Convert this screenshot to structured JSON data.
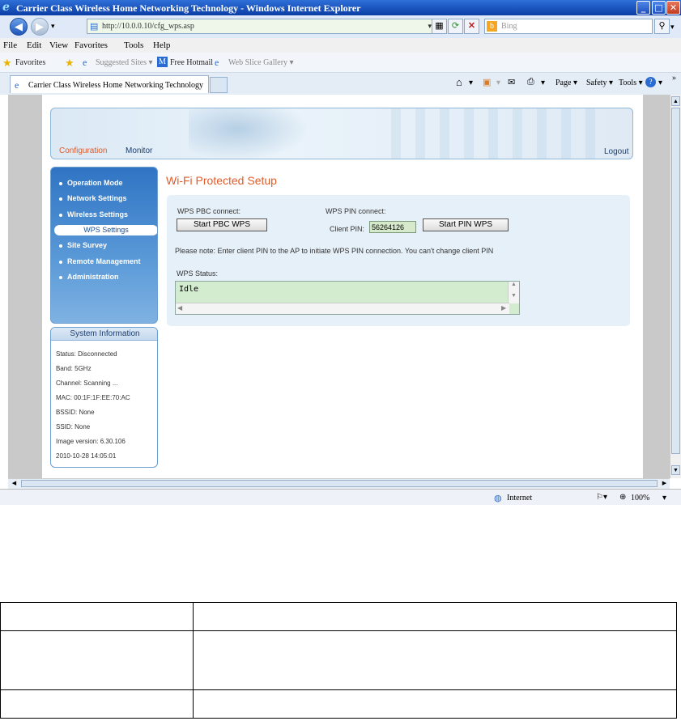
{
  "window": {
    "title": "Carrier Class Wireless Home Networking Technology - Windows Internet Explorer",
    "minimize": "_",
    "maximize": "□",
    "close": "✕"
  },
  "address_bar": {
    "url": "http://10.0.0.10/cfg_wps.asp",
    "search_placeholder": "Bing"
  },
  "menu": [
    "File",
    "Edit",
    "View",
    "Favorites",
    "Tools",
    "Help"
  ],
  "favorites_bar": {
    "favorites": "Favorites",
    "suggested": "Suggested Sites ▾",
    "hotmail": "Free Hotmail",
    "gallery": "Web Slice Gallery ▾"
  },
  "tab": {
    "title": "Carrier Class Wireless Home Networking Technology"
  },
  "command_bar": {
    "page": "Page ▾",
    "safety": "Safety ▾",
    "tools": "Tools ▾",
    "more": "»"
  },
  "router": {
    "tabs": {
      "configuration": "Configuration",
      "monitor": "Monitor"
    },
    "logout": "Logout",
    "nav": [
      "Operation Mode",
      "Network Settings",
      "Wireless Settings",
      "WPS Settings",
      "Site Survey",
      "Remote Management",
      "Administration"
    ],
    "system_info": {
      "heading": "System Information",
      "lines": [
        "Status: Disconnected",
        "Band: 5GHz",
        "Channel: Scanning ...",
        "MAC: 00:1F:1F:EE:70:AC",
        "BSSID: None",
        "SSID: None",
        "Image version: 6.30.106",
        "2010-10-28 14:05:01"
      ]
    },
    "page_title": "Wi-Fi Protected Setup",
    "wps": {
      "pbc_label": "WPS PBC connect:",
      "pbc_button": "Start PBC WPS",
      "pin_label": "WPS PIN connect:",
      "client_pin_label": "Client PIN:",
      "client_pin_value": "56264126",
      "pin_button": "Start PIN WPS",
      "note": "Please note: Enter client PIN to the AP to initiate WPS PIN connection. You can't change client PIN",
      "status_label": "WPS Status:",
      "status_value": "Idle"
    }
  },
  "status_bar": {
    "zone": "Internet",
    "zoom": "100%"
  }
}
